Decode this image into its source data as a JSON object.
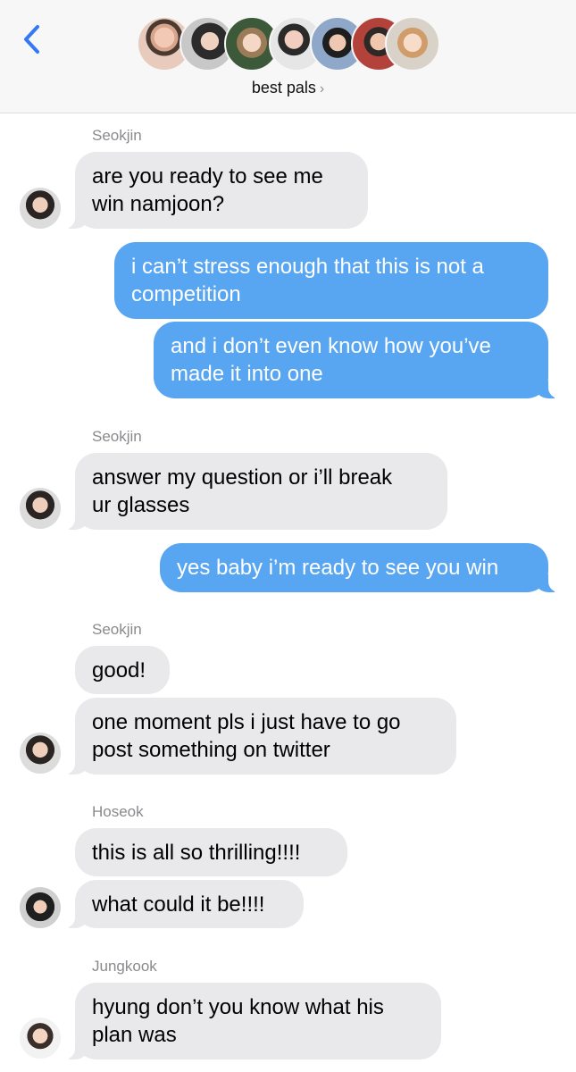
{
  "header": {
    "group_name": "best pals",
    "chevron": "›",
    "icons": {
      "back": "chevron-left-icon",
      "disclosure": "chevron-right-icon"
    },
    "accent": "#3478f6"
  },
  "colors": {
    "incoming": "#e9e9eb",
    "outgoing": "#58a6f1",
    "sender": "#8a8a8e"
  },
  "messages": [
    {
      "sender": "Seokjin",
      "lines": [
        "are you ready to see me",
        "win namjoon?"
      ]
    },
    {
      "lines": [
        "i can’t stress enough that this is not a",
        "competition"
      ]
    },
    {
      "lines": [
        "and i don’t even know how you’ve",
        "made it into one"
      ]
    },
    {
      "sender": "Seokjin",
      "lines": [
        "answer my question or i’ll break",
        "ur glasses"
      ]
    },
    {
      "lines": [
        "yes baby i’m ready to see you win"
      ]
    },
    {
      "sender": "Seokjin",
      "lines": [
        "good!"
      ]
    },
    {
      "lines": [
        "one moment pls i just have to go",
        "post something on twitter"
      ]
    },
    {
      "sender": "Hoseok",
      "lines": [
        "this is all so thrilling!!!!"
      ]
    },
    {
      "lines": [
        "what could it be!!!!"
      ]
    },
    {
      "sender": "Jungkook",
      "lines": [
        "hyung don’t you know what his",
        "plan was"
      ]
    }
  ]
}
